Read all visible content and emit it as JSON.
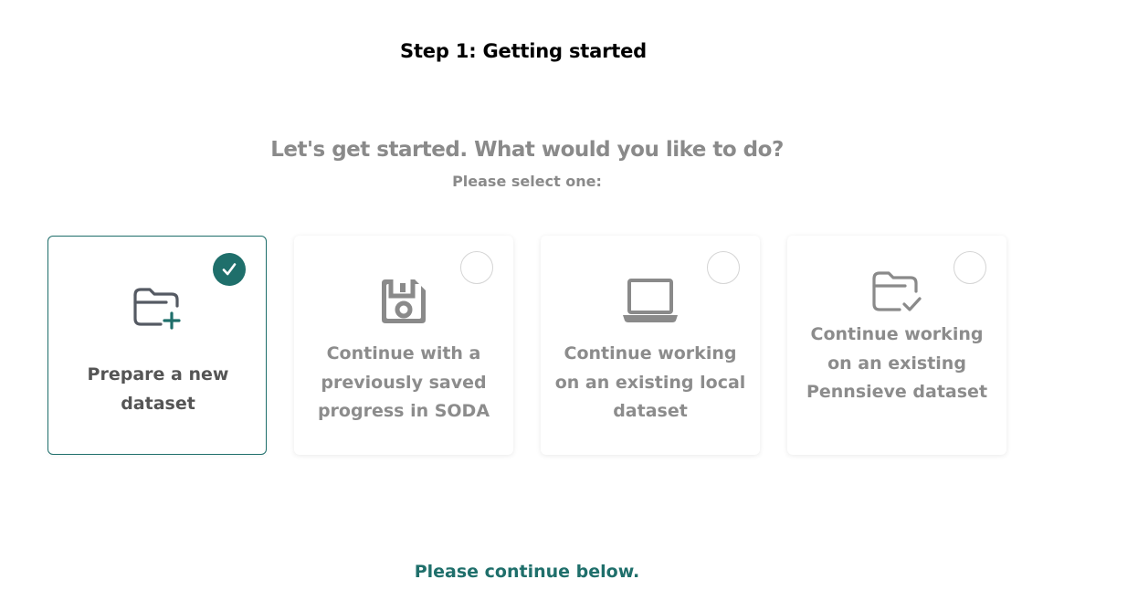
{
  "header": {
    "step_title": "Step 1: Getting started"
  },
  "prompt": {
    "question": "Let's get started. What would you like to do?",
    "instruction": "Please select one:"
  },
  "options": [
    {
      "label": "Prepare a new dataset",
      "icon": "folder-plus-icon",
      "selected": true
    },
    {
      "label": "Continue with a previously saved progress in SODA",
      "icon": "floppy-disk-icon",
      "selected": false
    },
    {
      "label": "Continue working on an existing local dataset",
      "icon": "laptop-icon",
      "selected": false
    },
    {
      "label": "Continue working on an existing Pennsieve dataset",
      "icon": "folder-check-icon",
      "selected": false
    }
  ],
  "footer": {
    "continue_text": "Please continue below."
  },
  "colors": {
    "accent": "#1f6f6b",
    "muted_text": "#8a8a8a",
    "selected_text": "#555555"
  }
}
